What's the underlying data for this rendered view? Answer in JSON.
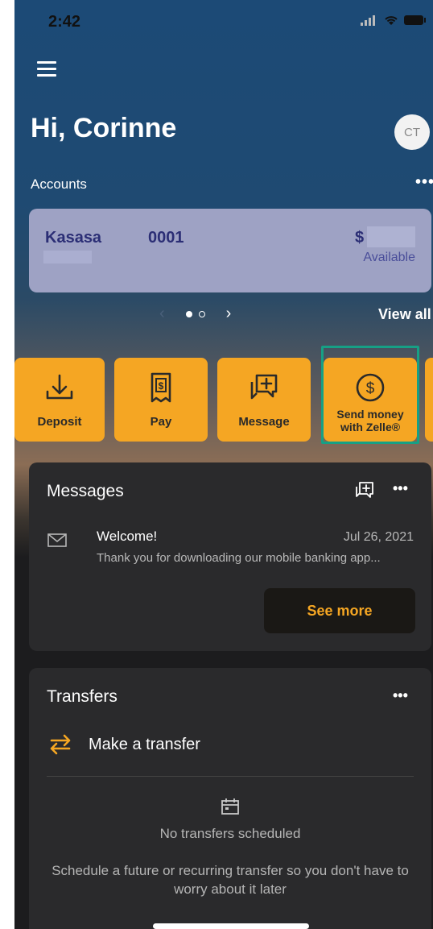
{
  "status_bar": {
    "time": "2:42"
  },
  "header": {
    "greeting": "Hi, Corinne",
    "avatar_initials": "CT"
  },
  "accounts": {
    "label": "Accounts",
    "more": "•••",
    "card": {
      "name": "Kasasa",
      "number": "0001",
      "balance_prefix": "$",
      "available_label": "Available"
    },
    "view_all": "View all"
  },
  "actions": [
    {
      "label": "Deposit",
      "icon": "deposit-icon"
    },
    {
      "label": "Pay",
      "icon": "bill-pay-icon"
    },
    {
      "label": "Message",
      "icon": "message-add-icon"
    },
    {
      "label_line1": "Send money",
      "label_line2": "with Zelle®",
      "icon": "dollar-coin-icon"
    }
  ],
  "messages": {
    "title": "Messages",
    "more": "•••",
    "item": {
      "title": "Welcome!",
      "date": "Jul 26, 2021",
      "body": "Thank you for downloading our mobile banking app..."
    },
    "see_more": "See more"
  },
  "transfers": {
    "title": "Transfers",
    "more": "•••",
    "action": "Make a transfer",
    "empty_title": "No transfers scheduled",
    "empty_desc": "Schedule a future or recurring transfer so you don't have to worry about it later"
  },
  "colors": {
    "accent": "#f5a623",
    "card_bg": "#2a2a2c",
    "account_card": "#9ea2c4",
    "zelle_highlight": "#16a085"
  }
}
